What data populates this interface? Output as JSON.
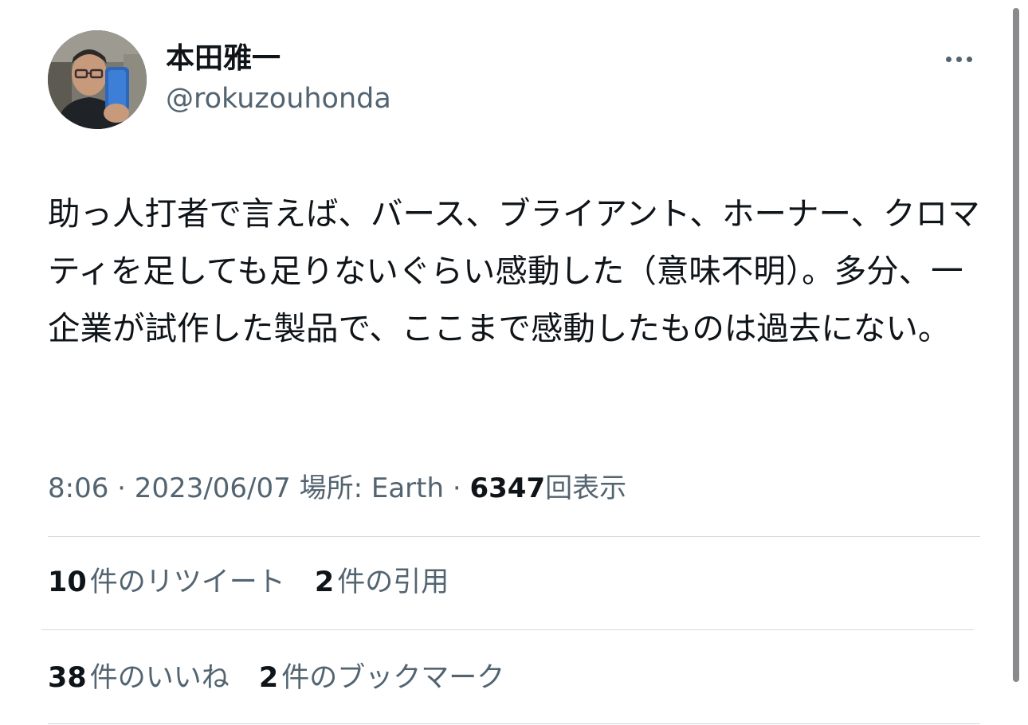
{
  "author": {
    "display_name": "本田雅一",
    "handle": "@rokuzouhonda"
  },
  "tweet": {
    "text": "助っ人打者で言えば、バース、ブライアント、ホーナー、クロマティを足しても足りないぐらい感動した（意味不明）。多分、一企業が試作した製品で、ここまで感動したものは過去にない。",
    "time": "8:06",
    "separator": "·",
    "date": "2023/06/07",
    "location_label": "場所: Earth",
    "views_count": "6347",
    "views_label": "回表示"
  },
  "stats": {
    "retweets": {
      "count": "10",
      "label": "件のリツイート"
    },
    "quotes": {
      "count": "2",
      "label": "件の引用"
    },
    "likes": {
      "count": "38",
      "label": "件のいいね"
    },
    "bookmarks": {
      "count": "2",
      "label": "件のブックマーク"
    }
  },
  "icons": {
    "more": "more-horizontal-icon"
  },
  "colors": {
    "text_primary": "#0f1419",
    "text_secondary": "#536471",
    "divider": "#cfd9de"
  }
}
